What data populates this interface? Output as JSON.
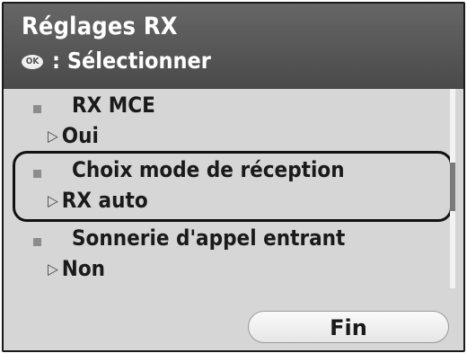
{
  "header": {
    "title": "Réglages RX",
    "ok_icon_label": "OK",
    "hint": ": Sélectionner"
  },
  "items": [
    {
      "label": "RX MCE",
      "value": "Oui"
    },
    {
      "label": "Choix mode de réception",
      "value": "RX auto",
      "selected": true
    },
    {
      "label": "Sonnerie d'appel entrant",
      "value": "Non"
    }
  ],
  "scroll": {
    "position": 0.45
  },
  "footer": {
    "fin_label": "Fin"
  }
}
